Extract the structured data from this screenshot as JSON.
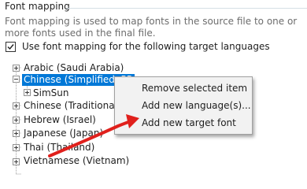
{
  "section": {
    "title": "Font mapping",
    "description": "Font mapping is used to map fonts in the source file to one or more fonts used in the final file."
  },
  "option": {
    "checked": true,
    "label": "Use font mapping for the following target languages"
  },
  "tree": {
    "items": [
      {
        "label": "Arabic (Saudi Arabia)",
        "expanded": false
      },
      {
        "label": "Chinese (Simplified, PR",
        "expanded": true,
        "selected": true
      },
      {
        "label": "SimSun",
        "expanded": false
      },
      {
        "label": "Chinese (Traditional, T",
        "expanded": false
      },
      {
        "label": "Hebrew (Israel)",
        "expanded": false
      },
      {
        "label": "Japanese (Japan)",
        "expanded": false
      },
      {
        "label": "Thai (Thailand)",
        "expanded": false
      },
      {
        "label": "Vietnamese (Vietnam)",
        "expanded": false
      }
    ]
  },
  "context_menu": {
    "items": [
      {
        "label": "Remove selected item"
      },
      {
        "label": "Add new language(s)..."
      },
      {
        "label": "Add new target font"
      }
    ]
  },
  "colors": {
    "selection": "#0078d7",
    "annotation_arrow": "#e0201c",
    "menu_background": "#f2f2f2"
  }
}
